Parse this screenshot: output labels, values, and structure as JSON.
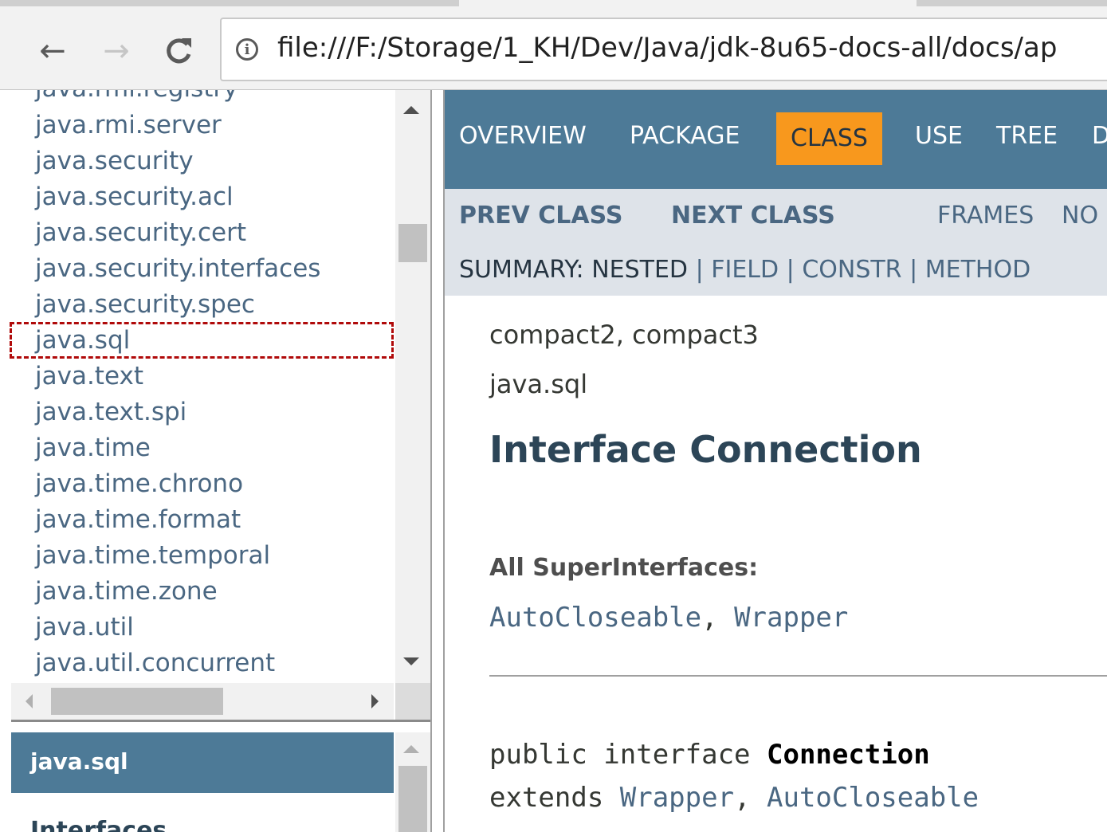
{
  "browser": {
    "back_icon": "arrow-left-icon",
    "forward_icon": "arrow-right-icon",
    "reload_icon": "reload-icon",
    "info_icon": "info-icon",
    "url": "file:///F:/Storage/1_KH/Dev/Java/jdk-8u65-docs-all/docs/ap"
  },
  "package_list": {
    "items": [
      "java.rmi.registry",
      "java.rmi.server",
      "java.security",
      "java.security.acl",
      "java.security.cert",
      "java.security.interfaces",
      "java.security.spec",
      "java.sql",
      "java.text",
      "java.text.spi",
      "java.time",
      "java.time.chrono",
      "java.time.format",
      "java.time.temporal",
      "java.time.zone",
      "java.util",
      "java.util.concurrent"
    ],
    "highlighted": "java.sql",
    "highlight_color": "#b00a0a"
  },
  "package_frame": {
    "title": "java.sql",
    "section": "Interfaces"
  },
  "top_nav": {
    "overview": "OVERVIEW",
    "package": "PACKAGE",
    "class": "CLASS",
    "use": "USE",
    "tree": "TREE",
    "deprecated": "D",
    "active_color": "#f8981d",
    "bar_color": "#4d7a97"
  },
  "sub_nav": {
    "prev_class": "PREV CLASS",
    "next_class": "NEXT CLASS",
    "frames": "FRAMES",
    "no_frames": "NO",
    "summary_label": "SUMMARY: NESTED",
    "summary_sep1": "|",
    "summary_field": "FIELD",
    "summary_sep2": "|",
    "summary_constr": "CONSTR",
    "summary_sep3": "|",
    "summary_method": "METHOD"
  },
  "content": {
    "profiles": "compact2, compact3",
    "package": "java.sql",
    "title": "Interface Connection",
    "super_label": "All SuperInterfaces:",
    "super_autocloseable": "AutoCloseable",
    "super_sep": ", ",
    "super_wrapper": "Wrapper",
    "sig_public": "public interface ",
    "sig_name": "Connection",
    "sig_extends": "extends ",
    "sig_wrapper": "Wrapper",
    "sig_sep": ", ",
    "sig_autocloseable": "AutoCloseable"
  }
}
